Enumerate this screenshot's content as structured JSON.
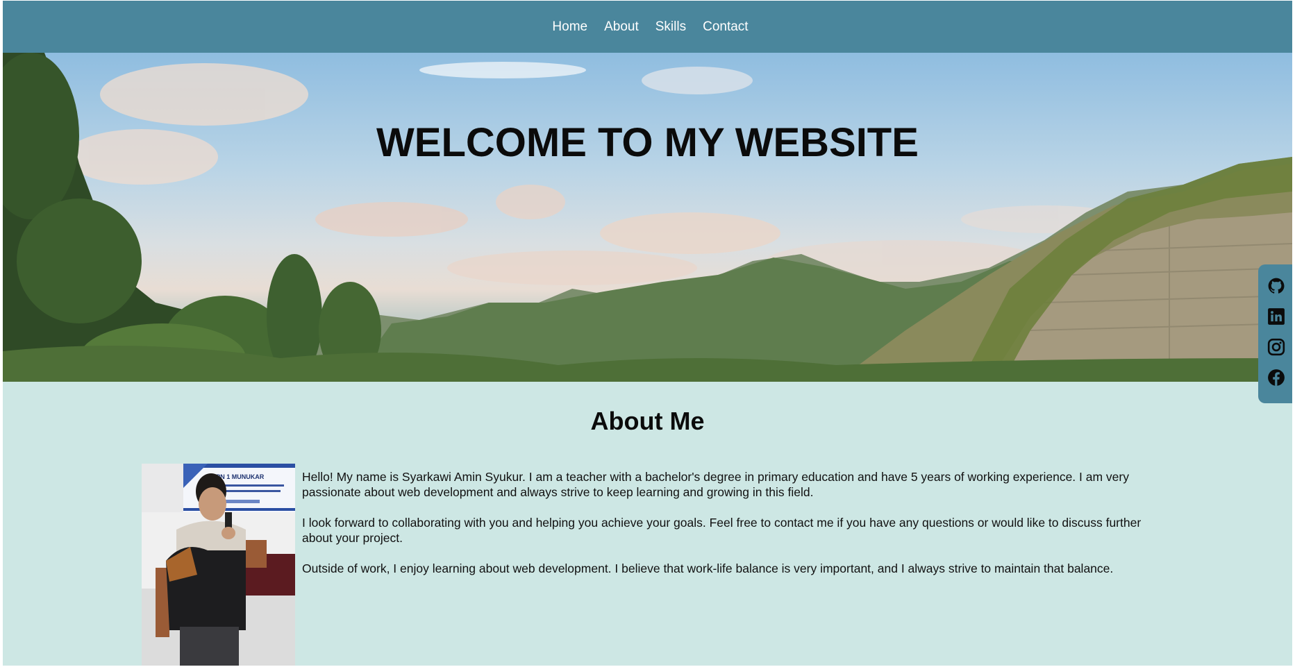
{
  "nav": {
    "items": [
      {
        "label": "Home"
      },
      {
        "label": "About"
      },
      {
        "label": "Skills"
      },
      {
        "label": "Contact"
      }
    ]
  },
  "hero": {
    "title": "WELCOME TO MY WEBSITE"
  },
  "social": {
    "icons": [
      "github-icon",
      "linkedin-icon",
      "instagram-icon",
      "facebook-icon"
    ]
  },
  "about": {
    "heading": "About Me",
    "paragraphs": [
      "Hello! My name is Syarkawi Amin Syukur. I am a teacher with a bachelor's degree in primary education and have 5 years of working experience. I am very passionate about web development and always strive to keep learning and growing in this field.",
      "I look forward to collaborating with you and helping you achieve your goals. Feel free to contact me if you have any questions or would like to discuss further about your project.",
      "Outside of work, I enjoy learning about web development. I believe that work-life balance is very important, and I always strive to maintain that balance."
    ],
    "photo_banner_text": "SMPN 1 MUNUKAR"
  },
  "colors": {
    "navbar": "#4a869c",
    "page_background": "#cde7e4",
    "nav_text": "#ffffff"
  }
}
